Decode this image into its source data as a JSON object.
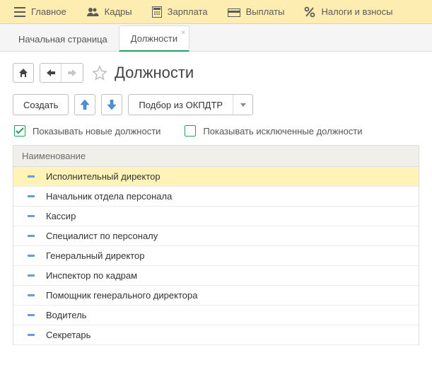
{
  "topbar": {
    "items": [
      {
        "label": "Главное"
      },
      {
        "label": "Кадры"
      },
      {
        "label": "Зарплата"
      },
      {
        "label": "Выплаты"
      },
      {
        "label": "Налоги и взносы"
      }
    ]
  },
  "tabs": {
    "start": "Начальная страница",
    "active": "Должности"
  },
  "page": {
    "title": "Должности"
  },
  "toolbar": {
    "create": "Создать",
    "picker": "Подбор из ОКПДТР"
  },
  "filters": {
    "show_new": {
      "label": "Показывать новые должности",
      "checked": true
    },
    "show_excluded": {
      "label": "Показывать исключенные должности",
      "checked": false
    }
  },
  "grid": {
    "header": "Наименование",
    "rows": [
      {
        "name": "Исполнительный директор",
        "selected": true
      },
      {
        "name": "Начальник отдела персонала",
        "selected": false
      },
      {
        "name": "Кассир",
        "selected": false
      },
      {
        "name": "Специалист по персоналу",
        "selected": false
      },
      {
        "name": "Генеральный директор",
        "selected": false
      },
      {
        "name": "Инспектор по кадрам",
        "selected": false
      },
      {
        "name": "Помощник генерального директора",
        "selected": false
      },
      {
        "name": "Водитель",
        "selected": false
      },
      {
        "name": "Секретарь",
        "selected": false
      }
    ]
  }
}
